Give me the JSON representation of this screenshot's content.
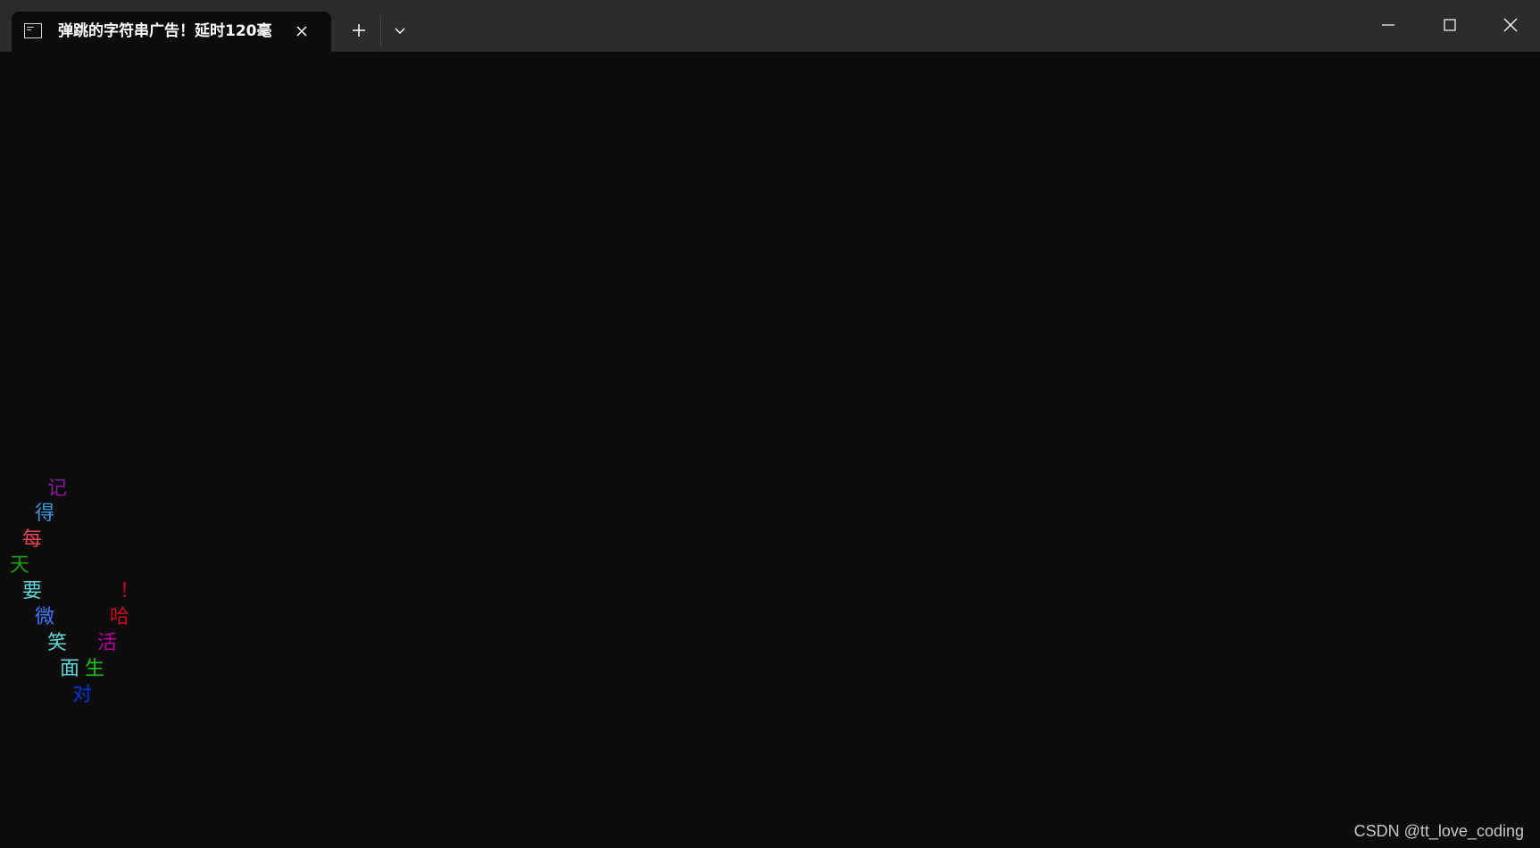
{
  "tab": {
    "title": "弹跳的字符串广告！延时120毫",
    "icon": "terminal-icon"
  },
  "icons": {
    "close_tab": "close-icon",
    "new_tab": "plus-icon",
    "dropdown": "chevron-down-icon",
    "minimize": "minimize-icon",
    "maximize": "maximize-icon",
    "close_window": "close-icon"
  },
  "terminal": {
    "background": "#0c0c0c",
    "characters": [
      {
        "char": "记",
        "color": "#881798"
      },
      {
        "char": "得",
        "color": "#3a96dd"
      },
      {
        "char": "每",
        "color": "#e74856"
      },
      {
        "char": "天",
        "color": "#13a10e"
      },
      {
        "char": "要",
        "color": "#61d6d6"
      },
      {
        "char": "微",
        "color": "#3b78ff"
      },
      {
        "char": "笑",
        "color": "#61d6d6"
      },
      {
        "char": "面",
        "color": "#61d6d6"
      },
      {
        "char": "对",
        "color": "#0037da"
      },
      {
        "char": "生",
        "color": "#16c60c"
      },
      {
        "char": "活",
        "color": "#b4009e"
      },
      {
        "char": "哈",
        "color": "#c50f1f"
      },
      {
        "char": "！",
        "color": "#c50f1f"
      }
    ]
  },
  "watermark": "CSDN @tt_love_coding"
}
